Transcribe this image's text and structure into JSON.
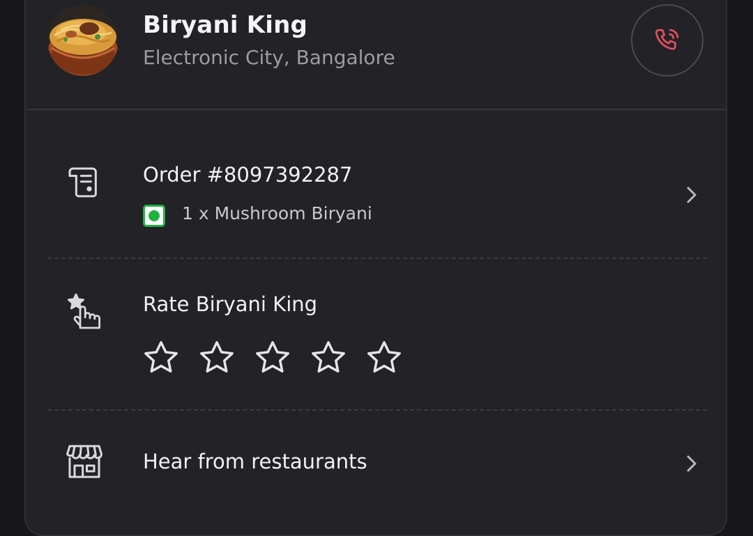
{
  "restaurant": {
    "name": "Biryani King",
    "location": "Electronic City, Bangalore",
    "avatar_icon": "biryani-bowl-image",
    "call_icon": "phone-call-icon",
    "call_icon_color": "#e0505f"
  },
  "order": {
    "title": "Order #8097392287",
    "item": "1 x Mushroom Biryani",
    "veg_color": "#1fb240",
    "icon": "receipt-icon"
  },
  "rating": {
    "title": "Rate Biryani King",
    "stars_total": 5,
    "stars_selected": 0,
    "icon": "tap-star-icon"
  },
  "feedback": {
    "title": "Hear from restaurants",
    "icon": "storefront-icon"
  }
}
